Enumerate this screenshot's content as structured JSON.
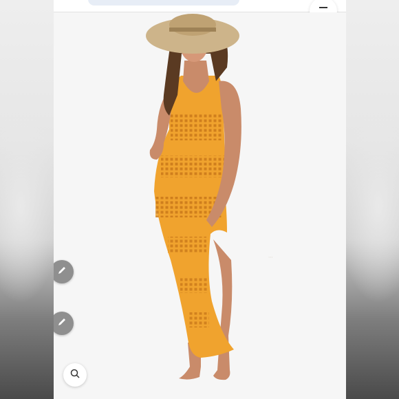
{
  "colors": {
    "dress": "#f0a32e",
    "dress_shadow": "#d88a1c",
    "hat": "#cdb48a",
    "skin": "#c98b6a",
    "hair": "#5a3a22",
    "background": "#f4f4f4"
  },
  "icons": {
    "edit_top": "pencil-icon",
    "edit_bottom": "pencil-icon",
    "zoom": "magnifier-icon",
    "menu": "menu-icon"
  }
}
